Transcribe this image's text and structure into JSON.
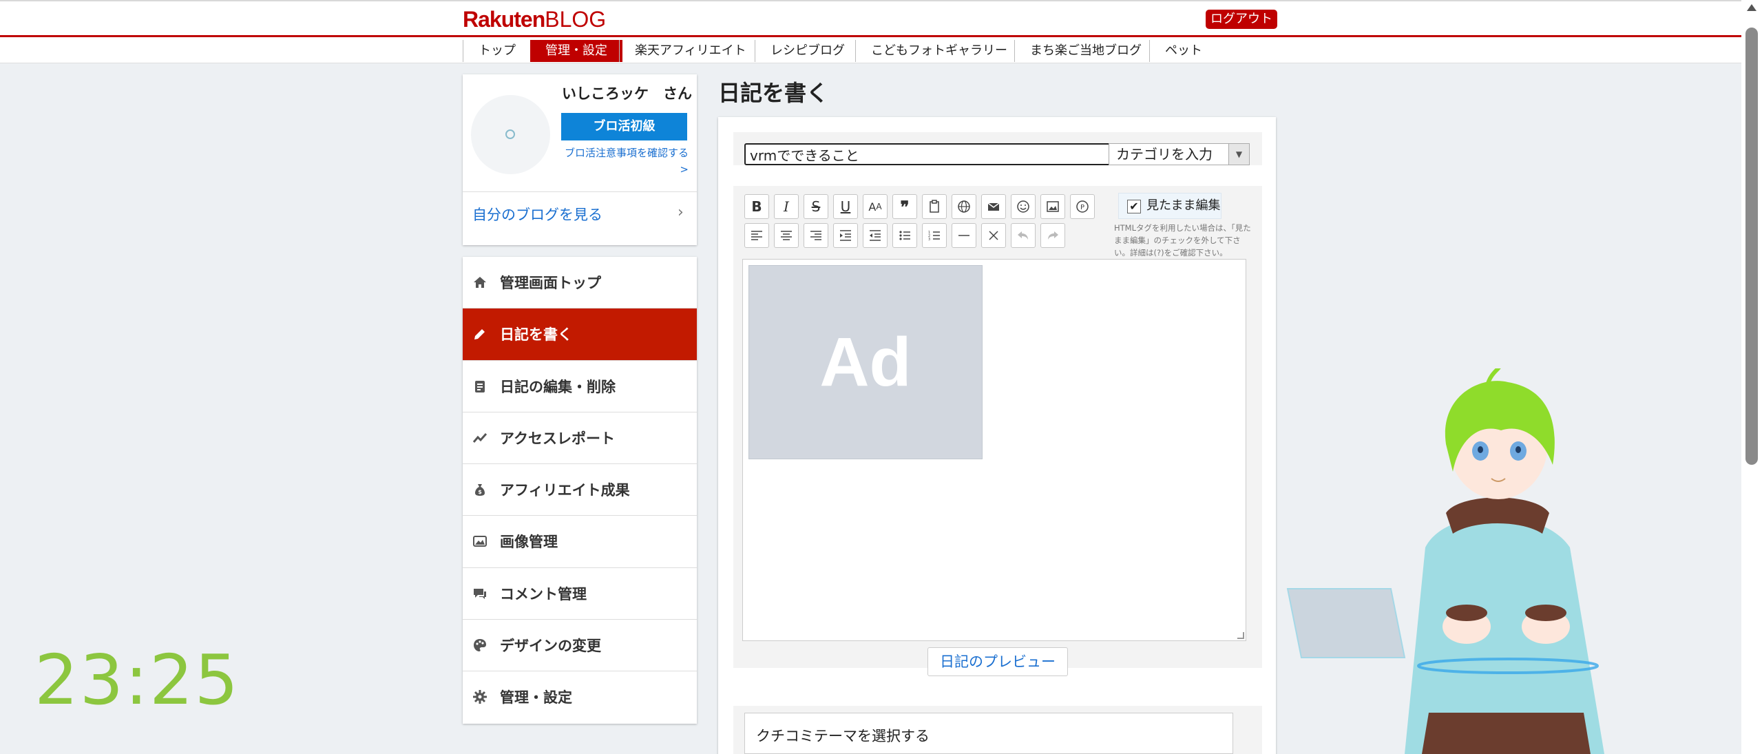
{
  "header": {
    "logo_rakuten": "Rakuten",
    "logo_blog": "BLOG",
    "logout_label": "ログアウト"
  },
  "nav": {
    "items": [
      {
        "label": "トップ",
        "active": false
      },
      {
        "label": "管理・設定",
        "active": true
      },
      {
        "label": "楽天アフィリエイト",
        "active": false
      },
      {
        "label": "レシピブログ",
        "active": false
      },
      {
        "label": "こどもフォトギャラリー",
        "active": false
      },
      {
        "label": "まち楽ご当地ブログ",
        "active": false
      },
      {
        "label": "ペット",
        "active": false
      }
    ]
  },
  "profile": {
    "username": "いしころッケ　さん",
    "rank_label": "ブロ活初級",
    "notice_link": "ブロ活注意事項を確認する>",
    "blog_link": "自分のブログを見る"
  },
  "sidebar": {
    "items": [
      {
        "label": "管理画面トップ",
        "icon": "home-icon"
      },
      {
        "label": "日記を書く",
        "icon": "pencil-icon",
        "active": true
      },
      {
        "label": "日記の編集・削除",
        "icon": "document-icon"
      },
      {
        "label": "アクセスレポート",
        "icon": "trend-icon"
      },
      {
        "label": "アフィリエイト成果",
        "icon": "money-bag-icon"
      },
      {
        "label": "画像管理",
        "icon": "image-icon"
      },
      {
        "label": "コメント管理",
        "icon": "comment-icon"
      },
      {
        "label": "デザインの変更",
        "icon": "palette-icon"
      },
      {
        "label": "管理・設定",
        "icon": "gear-icon"
      }
    ]
  },
  "clock": {
    "time": "23:25"
  },
  "editor": {
    "page_title": "日記を書く",
    "title_value": "vrmでできること",
    "category_placeholder": "カテゴリを入力",
    "wysiwyg_label": "見たまま編集",
    "wysiwyg_checked": true,
    "wysiwyg_note": "HTMLタグを利用したい場合は、「見たまま編集」のチェックを外して下さい。詳細は(?)をご確認下さい。",
    "ad_label": "Ad",
    "preview_label": "日記のプレビュー",
    "theme_label": "クチコミテーマを選択する"
  },
  "colors": {
    "brand": "#bf0000",
    "sidebar_active": "#c21a00",
    "primary_button": "#0e84d8",
    "link": "#1a6fd0",
    "clock": "#8cc63f"
  }
}
